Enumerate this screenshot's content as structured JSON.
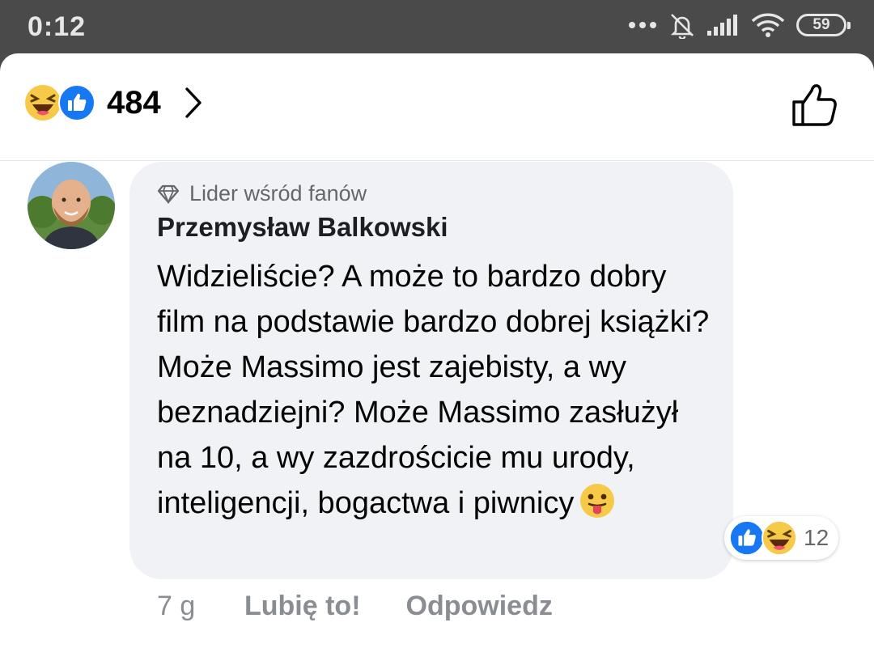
{
  "status_bar": {
    "time": "0:12",
    "battery": "59",
    "icons": [
      "more-dots-icon",
      "bell-muted-icon",
      "signal-icon",
      "wifi-icon",
      "battery-icon"
    ]
  },
  "reactions_header": {
    "emojis": [
      "laughing-emoji-icon",
      "like-reaction-icon"
    ],
    "count": "484"
  },
  "comment": {
    "badge": "Lider wśród fanów",
    "author": "Przemysław Balkowski",
    "text": "Widzieliście? A może to bardzo dobry film na podstawie bardzo dobrej książki? Może Massimo jest zajebisty, a wy beznadziejni? Może Massimo zasłużył na 10, a wy zazdrościcie mu urody, inteligencji, bogactwa i piwnicy",
    "reaction_count": "12",
    "time_ago": "7 g",
    "like_label": "Lubię to!",
    "reply_label": "Odpowiedz"
  },
  "colors": {
    "like_blue": "#1877f2",
    "emoji_yellow": "#f7c948",
    "bubble_bg": "#f0f2f5",
    "muted_text": "#65676b"
  }
}
